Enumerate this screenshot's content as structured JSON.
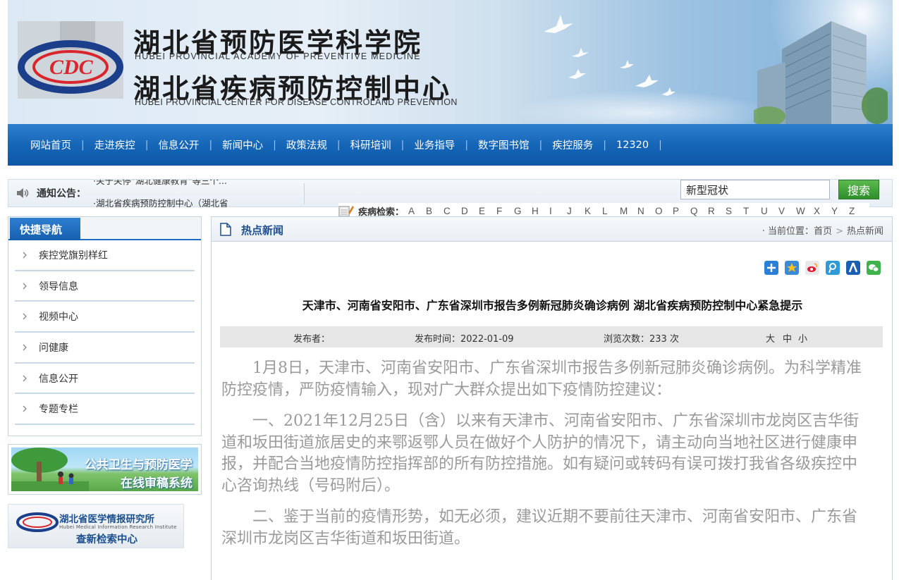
{
  "header": {
    "title_cn1": "湖北省预防医学科学院",
    "title_en1": "HUBEI PROVINCIAL ACADEMY OF PREVENTIVE MEDICINE",
    "title_cn2": "湖北省疾病预防控制中心",
    "title_en2": "HUBEI PROVINCIAL CENTER FOR DISEASE CONTROLAND PREVENTION",
    "logo_text": "CDC"
  },
  "nav": {
    "items": [
      "网站首页",
      "走进疾控",
      "信息公开",
      "新闻中心",
      "政策法规",
      "科研培训",
      "业务指导",
      "数字图书馆",
      "疾控服务",
      "12320"
    ],
    "separator": "|"
  },
  "notice": {
    "label": "通知公告：",
    "line1": "·关于关停\"湖北健康教育\"等三个...",
    "line2": "·湖北省疾病预防控制中心（湖北省"
  },
  "search": {
    "value": "新型冠状",
    "button": "搜索"
  },
  "disease_search": {
    "label": "疾病检索：",
    "letters": [
      "A",
      "B",
      "C",
      "D",
      "E",
      "F",
      "G",
      "H",
      "I",
      "J",
      "K",
      "L",
      "M",
      "N",
      "O",
      "P",
      "Q",
      "R",
      "S",
      "T",
      "U",
      "V",
      "W",
      "X",
      "Y",
      "Z"
    ]
  },
  "sidebar": {
    "title": "快捷导航",
    "items": [
      "疾控党旗别样红",
      "领导信息",
      "视频中心",
      "问健康",
      "信息公开",
      "专题专栏"
    ],
    "ad1_line1": "公共卫生与预防医学",
    "ad1_line2": "在线审稿系统",
    "ad2_title": "湖北省医学情报研究所",
    "ad2_en": "Hubei Medical Information Research Institute",
    "ad2_sub": "查新检索中心"
  },
  "main": {
    "section_title": "热点新闻",
    "breadcrumb_prefix": "· 当前位置：",
    "breadcrumb_home": "首页",
    "breadcrumb_arrow": ">",
    "breadcrumb_current": "热点新闻",
    "article_title": "天津市、河南省安阳市、广东省深圳市报告多例新冠肺炎确诊病例 湖北省疾病预防控制中心紧急提示",
    "meta": {
      "publisher": "发布者：",
      "date": "发布时间：2022-01-09",
      "views": "浏览次数：233 次",
      "size_large": "大",
      "size_medium": "中",
      "size_small": "小"
    },
    "paragraphs": [
      "1月8日，天津市、河南省安阳市、广东省深圳市报告多例新冠肺炎确诊病例。为科学精准防控疫情，严防疫情输入，现对广大群众提出如下疫情防控建议：",
      "一、2021年12月25日（含）以来有天津市、河南省安阳市、广东省深圳市龙岗区吉华街道和坂田街道旅居史的来鄂返鄂人员在做好个人防护的情况下，请主动向当地社区进行健康申报，并配合当地疫情防控指挥部的所有防控措施。如有疑问或转码有误可拨打我省各级疾控中心咨询热线（号码附后）。",
      "二、鉴于当前的疫情形势，如无必须，建议近期不要前往天津市、河南省安阳市、广东省深圳市龙岗区吉华街道和坂田街道。"
    ],
    "share_icons": [
      "add-share-icon",
      "qzone-icon",
      "weibo-icon",
      "tencent-weibo-icon",
      "renren-icon",
      "wechat-icon"
    ]
  },
  "colors": {
    "nav_blue": "#1464b6",
    "accent_green": "#2f8d2b",
    "title_blue": "#1d4f8e"
  }
}
